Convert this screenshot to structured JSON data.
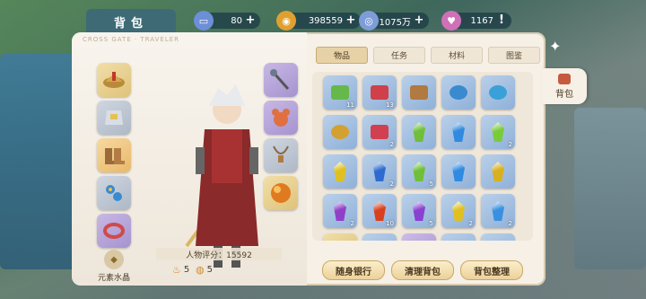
{
  "header": {
    "title": "背包",
    "resources": [
      {
        "name": "ticket",
        "value": "80",
        "icon": "ticket-icon",
        "color": "#6c8fd8"
      },
      {
        "name": "gold",
        "value": "398559",
        "icon": "gold-coin-icon",
        "color": "#e0a030"
      },
      {
        "name": "silver",
        "value": "1075万",
        "icon": "silver-coin-icon",
        "color": "#7d9cd8"
      },
      {
        "name": "gem",
        "value": "1167",
        "icon": "heart-gem-icon",
        "color": "#d070b8"
      }
    ],
    "add_symbol": "+",
    "alert_symbol": "!"
  },
  "character": {
    "subtitle": "CROSS GATE · TRAVELER",
    "score_label": "人物评分：15592",
    "element_crystal_label": "元素水晶",
    "counter_left": "5",
    "counter_right": "5",
    "left_slots": [
      "helmet-icon",
      "armor-icon",
      "boots-icon",
      "accessory-icon",
      "bracelet-icon"
    ],
    "right_slots": [
      "staff-icon",
      "pet-bear-icon",
      "necklace-icon",
      "orb-icon"
    ]
  },
  "inventory": {
    "tabs": [
      {
        "label": "物品",
        "active": true
      },
      {
        "label": "任务",
        "active": false
      },
      {
        "label": "材料",
        "active": false
      },
      {
        "label": "图鉴",
        "active": false
      }
    ],
    "items": [
      {
        "icon": "green-ticket-icon",
        "count": "11",
        "bg": "blue",
        "color": "#66b84a"
      },
      {
        "icon": "red-ticket-icon",
        "count": "13",
        "bg": "blue",
        "color": "#d0404a"
      },
      {
        "icon": "necklace-icon",
        "count": "",
        "bg": "blue",
        "color": "#b07a40"
      },
      {
        "icon": "earring-blue-icon",
        "count": "",
        "bg": "blue",
        "color": "#3a8ad0"
      },
      {
        "icon": "ring-blue-gem-icon",
        "count": "",
        "bg": "blue",
        "color": "#3aa0d8"
      },
      {
        "icon": "earring-gold-icon",
        "count": "",
        "bg": "blue",
        "color": "#d4a030"
      },
      {
        "icon": "bow-ribbon-icon",
        "count": "2",
        "bg": "blue",
        "color": "#d04050"
      },
      {
        "icon": "green-crystal-icon",
        "count": "",
        "bg": "blue",
        "color": "#6fbf3a"
      },
      {
        "icon": "blue-crystal-icon",
        "count": "",
        "bg": "blue",
        "color": "#2f8ae0"
      },
      {
        "icon": "green-crystal-icon",
        "count": "2",
        "bg": "blue",
        "color": "#7acb3a"
      },
      {
        "icon": "yellow-crystal-icon",
        "count": "",
        "bg": "blue",
        "color": "#e0c020"
      },
      {
        "icon": "blue-crystal-icon",
        "count": "2",
        "bg": "blue",
        "color": "#2f6ad0"
      },
      {
        "icon": "green-crystal-icon",
        "count": "5",
        "bg": "blue",
        "color": "#6fbf3a"
      },
      {
        "icon": "blue-crystal-icon",
        "count": "",
        "bg": "blue",
        "color": "#2f8ae0"
      },
      {
        "icon": "yellow-crystal-icon",
        "count": "",
        "bg": "blue",
        "color": "#d8b020"
      },
      {
        "icon": "purple-crystal-icon",
        "count": "2",
        "bg": "blue",
        "color": "#9040c8"
      },
      {
        "icon": "red-crystal-icon",
        "count": "10",
        "bg": "blue",
        "color": "#d84020"
      },
      {
        "icon": "purple-crystal-icon",
        "count": "5",
        "bg": "blue",
        "color": "#8a40d0"
      },
      {
        "icon": "yellow-crystal-icon",
        "count": "2",
        "bg": "blue",
        "color": "#e0c020"
      },
      {
        "icon": "blue-crystal-icon",
        "count": "2",
        "bg": "blue",
        "color": "#3a90e0"
      },
      {
        "icon": "gold-crystal-icon",
        "count": "",
        "bg": "yellow",
        "color": "#e0a020"
      },
      {
        "icon": "green-crystal-icon",
        "count": "",
        "bg": "blue",
        "color": "#6fbf3a"
      },
      {
        "icon": "purple-crystal-icon",
        "count": "",
        "bg": "purple",
        "color": "#9040c8"
      },
      {
        "icon": "blue-crystal-icon",
        "count": "",
        "bg": "blue",
        "color": "#3a8ad0"
      },
      {
        "icon": "blue-crystal-icon",
        "count": "",
        "bg": "blue",
        "color": "#3a8ad0"
      }
    ],
    "buttons": [
      "随身银行",
      "清理背包",
      "背包整理"
    ]
  },
  "side_tab": {
    "label": "背包",
    "icon": "bag-icon"
  }
}
